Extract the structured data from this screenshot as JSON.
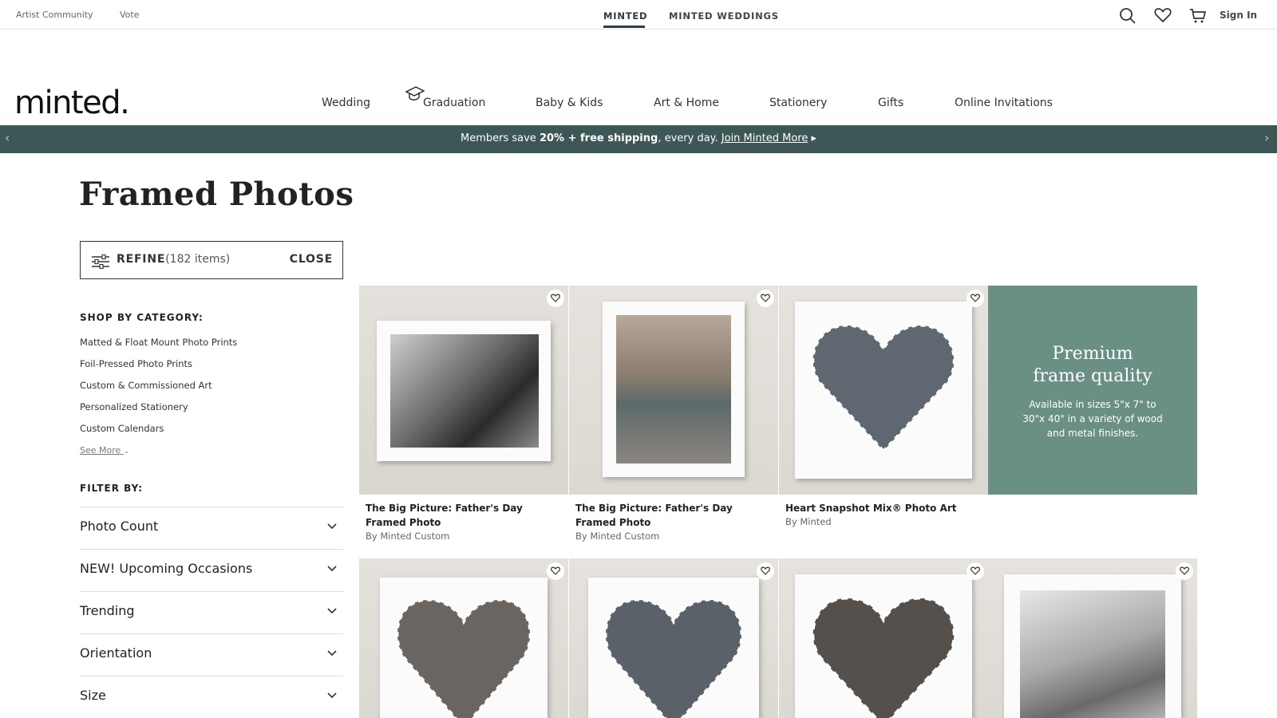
{
  "topbar": {
    "left_links": [
      "Artist Community",
      "Vote"
    ],
    "brand_tabs": [
      "MINTED",
      "MINTED WEDDINGS"
    ],
    "active_tab": "MINTED",
    "sign_in": "Sign In"
  },
  "logo": "minted.",
  "nav": {
    "items": [
      "Wedding",
      "Graduation",
      "Baby & Kids",
      "Art & Home",
      "Stationery",
      "Gifts",
      "Online Invitations"
    ]
  },
  "banner": {
    "prefix": "Members save ",
    "bold": "20% + free shipping",
    "middle": ", every day. ",
    "link": "Join Minted More",
    "suffix": " ▸",
    "prev_arrow": "‹",
    "next_arrow": "›"
  },
  "page_title": "Framed Photos",
  "refine": {
    "label": "REFINE",
    "count": "(182 items)",
    "close": "CLOSE"
  },
  "sidebar": {
    "shop_heading": "SHOP BY CATEGORY:",
    "categories": [
      "Matted & Float Mount Photo Prints",
      "Foil-Pressed Photo Prints",
      "Custom & Commissioned Art",
      "Personalized Stationery",
      "Custom Calendars"
    ],
    "see_more": "See More",
    "filter_heading": "FILTER BY:",
    "filters": [
      "Photo Count",
      "NEW! Upcoming Occasions",
      "Trending",
      "Orientation",
      "Size"
    ]
  },
  "products": [
    {
      "title": "The Big Picture: Father's Day Framed Photo",
      "by": "By Minted Custom"
    },
    {
      "title": "The Big Picture: Father's Day Framed Photo",
      "by": "By Minted Custom"
    },
    {
      "title": "Heart Snapshot Mix® Photo Art",
      "by": "By Minted"
    }
  ],
  "promo_tile": {
    "title_line1": "Premium",
    "title_line2": "frame quality",
    "body": "Available in sizes 5\"x 7\" to 30\"x 40\" in a variety of wood and metal finishes."
  },
  "colors": {
    "banner_bg": "#3d5656",
    "promo_bg": "#6a8f84",
    "active_underline": "#2c3a46"
  },
  "icons": [
    "search-icon",
    "heart-icon",
    "cart-icon",
    "filter-sliders-icon",
    "chevron-down-icon",
    "graduation-cap-icon"
  ]
}
